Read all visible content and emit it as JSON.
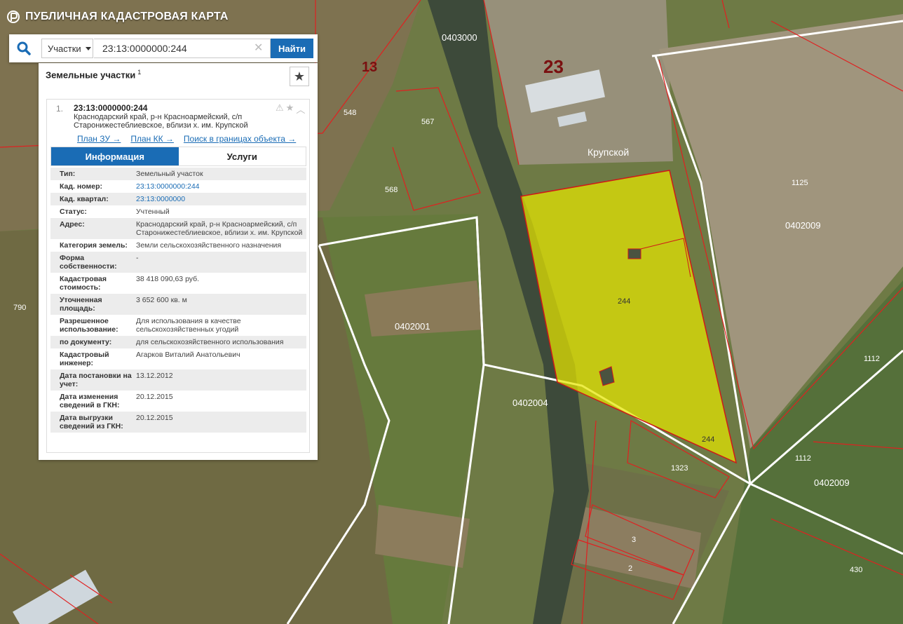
{
  "app": {
    "title": "ПУБЛИЧНАЯ КАДАСТРОВАЯ КАРТА"
  },
  "search": {
    "category": "Участки",
    "query": "23:13:0000000:244",
    "submit_label": "Найти"
  },
  "panel": {
    "title": "Земельные участки",
    "count": "1",
    "result": {
      "number": "1.",
      "cadastral_id": "23:13:0000000:244",
      "address": "Краснодарский край, р-н Красноармейский, с/п Старонижестеблиевское, вблизи х. им. Крупской",
      "links": {
        "plan_zu": "План ЗУ →",
        "plan_kk": "План КК →",
        "search_within": "Поиск в границах объекта →"
      },
      "tabs": {
        "info": "Информация",
        "services": "Услуги"
      },
      "fields": [
        {
          "key": "Тип:",
          "value": "Земельный участок"
        },
        {
          "key": "Кад. номер:",
          "value": "23:13:0000000:244"
        },
        {
          "key": "Кад. квартал:",
          "value": "23:13:0000000"
        },
        {
          "key": "Статус:",
          "value": "Учтенный"
        },
        {
          "key": "Адрес:",
          "value": "Краснодарский край, р-н Красноармейский, с/п Старонижестеблиевское, вблизи х. им. Крупской"
        },
        {
          "key": "Категория земель:",
          "value": "Земли сельскохозяйственного назначения"
        },
        {
          "key": "Форма собственности:",
          "value": "-"
        },
        {
          "key": "Кадастровая стоимость:",
          "value": "38 418 090,63 руб."
        },
        {
          "key": "Уточненная площадь:",
          "value": "3 652 600 кв. м"
        },
        {
          "key": "Разрешенное использование:",
          "value": "Для использования в качестве сельскохозяйственных угодий"
        },
        {
          "key": "по документу:",
          "value": "для сельскохозяйственного использования"
        },
        {
          "key": "Кадастровый инженер:",
          "value": "Агарков Виталий Анатольевич"
        },
        {
          "key": "Дата постановки на учет:",
          "value": "13.12.2012"
        },
        {
          "key": "Дата изменения сведений в ГКН:",
          "value": "20.12.2015"
        },
        {
          "key": "Дата выгрузки сведений из ГКН:",
          "value": "20.12.2015"
        }
      ]
    }
  },
  "map": {
    "labels": {
      "q_0403000": "0403000",
      "q_0402009_a": "0402009",
      "q_0402009_b": "0402009",
      "q_0402001": "0402001",
      "q_0402004": "0402004",
      "district_23": "23",
      "district_13": "13",
      "place_krupskoy": "Крупской",
      "parcel_244_a": "244",
      "parcel_244_b": "244",
      "p548": "548",
      "p567": "567",
      "p568": "568",
      "p790": "790",
      "p1125": "1125",
      "p1112_a": "1112",
      "p1112_b": "1112",
      "p1323": "1323",
      "p3": "3",
      "p2": "2",
      "p430": "430"
    },
    "colors": {
      "highlight": "#e6e600",
      "boundary": "#e02020",
      "road": "#ffffff",
      "brand": "#1a6cb5"
    }
  }
}
